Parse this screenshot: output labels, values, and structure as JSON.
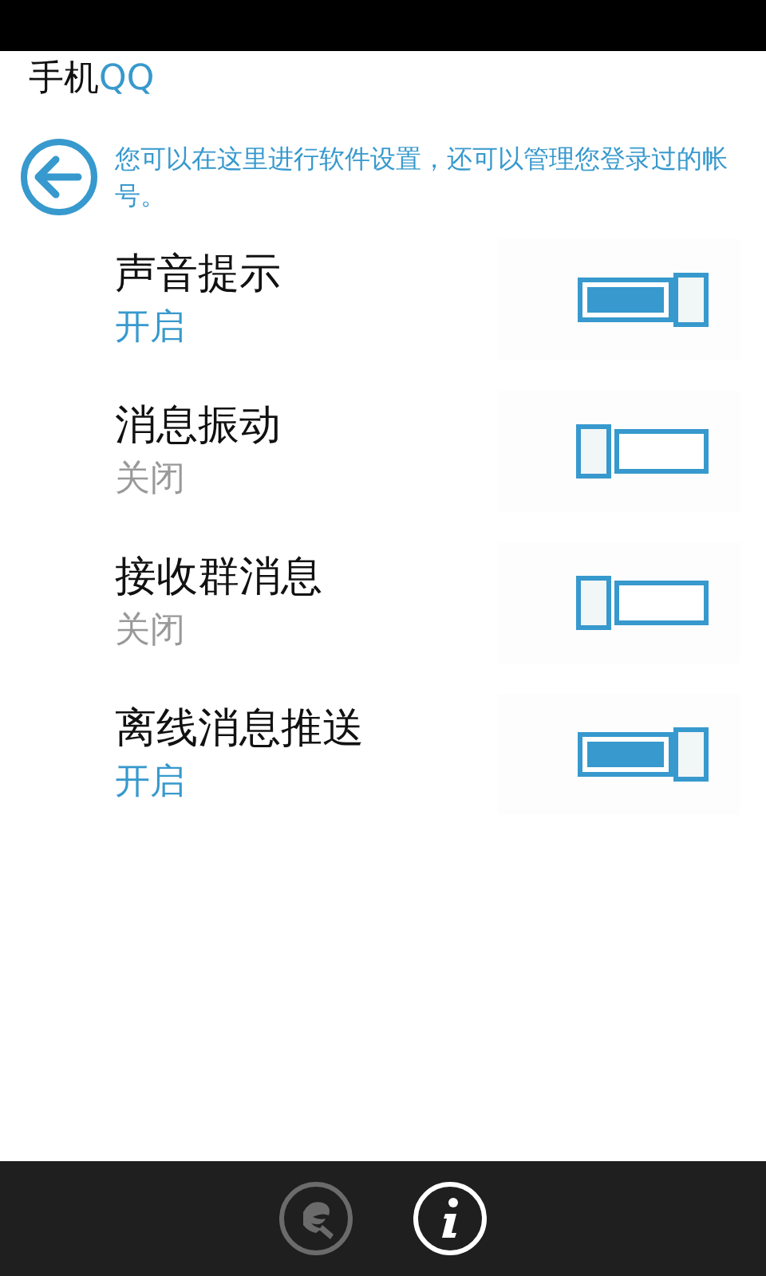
{
  "header": {
    "title_prefix": "手机",
    "title_suffix": "QQ"
  },
  "intro": {
    "text": "您可以在这里进行软件设置，还可以管理您登录过的帐号。"
  },
  "settings": [
    {
      "label": "声音提示",
      "status": "开启",
      "on": true
    },
    {
      "label": "消息振动",
      "status": "关闭",
      "on": false
    },
    {
      "label": "接收群消息",
      "status": "关闭",
      "on": false
    },
    {
      "label": "离线消息推送",
      "status": "开启",
      "on": true
    }
  ],
  "app_bar": [
    {
      "kind": "tools",
      "disabled": true
    },
    {
      "kind": "info",
      "disabled": false
    }
  ]
}
